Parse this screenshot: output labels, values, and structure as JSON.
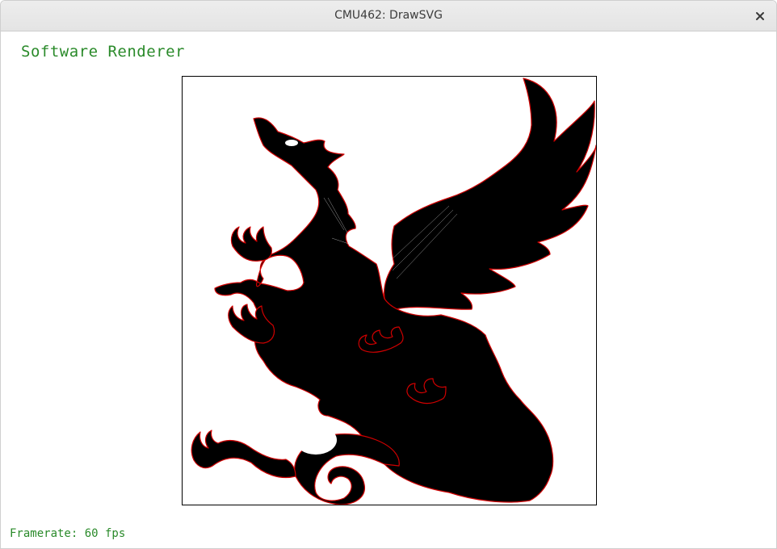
{
  "window": {
    "title": "CMU462: DrawSVG"
  },
  "renderer": {
    "label": "Software Renderer"
  },
  "status": {
    "framerate": "Framerate: 60 fps"
  },
  "colors": {
    "label_green": "#2a8a2a",
    "fill_black": "#000000",
    "outline_red": "#d00000"
  },
  "icons": {
    "close": "close-icon"
  }
}
